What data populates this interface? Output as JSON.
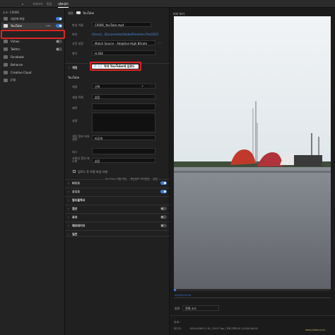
{
  "tabs": {
    "home": "⌂",
    "import": "가져오기",
    "edit": "편집",
    "export": "내보내기"
  },
  "sidebar": {
    "header": "소스: C0006",
    "items": [
      {
        "label": "대상에 파일",
        "toggle": true
      },
      {
        "label": "YouTube",
        "toggle": true,
        "selected": true,
        "more": "•••"
      },
      {
        "label": "Vimeo",
        "toggle": false
      },
      {
        "label": "Twitter",
        "toggle": false
      },
      {
        "label": "Facebook",
        "toggle": false
      },
      {
        "label": "Behance",
        "toggle": false
      },
      {
        "label": "Creative Cloud",
        "toggle": false
      },
      {
        "label": "FTP",
        "toggle": false
      }
    ]
  },
  "middle": {
    "header_label": "설정:",
    "header_value": "YouTube",
    "file_name_label": "파일 이름",
    "file_name": "C0006_YouTube.mp4",
    "location_label": "위치",
    "location": "/Users/.../Documents/Adobe/Premiere Pro/2022",
    "preset_label": "사전 설정",
    "preset": "Match Source - Adaptive High Bitrate",
    "format_label": "형식",
    "format": "H.264",
    "account_section": "계정",
    "login_button": "로그인",
    "upload_notice": "하여 YouTube에 업로드",
    "youtube_label": "YouTube",
    "channel_label": "채널",
    "channel_value": "선택",
    "playlist_label": "재생 목록",
    "playlist_value": "없음",
    "title_label": "제목",
    "desc_label": "설명",
    "privacy_label": "개인 정보 보호 설정",
    "privacy_value": "비공개",
    "tags_label": "태그",
    "thumb_label": "사용자 정의 축소판",
    "thumb_value": "없음",
    "delete_check": "업로드 후 로컬 파일 삭제",
    "links": [
      "YouTube 이용 약관",
      "개인정보 처리방침",
      "설정"
    ],
    "sections": [
      "비디오",
      "오디오",
      "멀티플렉서",
      "캡션",
      "효과",
      "메타데이터",
      "일반"
    ],
    "section_toggles": [
      true,
      true,
      null,
      false,
      false,
      false,
      null
    ]
  },
  "preview": {
    "title": "미리 보기",
    "time": "00;00;00;00",
    "range_label": "범위",
    "range_value": "전체 소스",
    "source_label": "소스:",
    "info_label": "비디오:",
    "info_value": "1920x1080 (1.0)  |  29.97 fps  |  프로그레시브  |  00;00;48;28",
    "watermark": "www.ivideo.co.kr"
  },
  "colors": {
    "accent": "#3b7bd9",
    "highlight": "#e02424"
  }
}
